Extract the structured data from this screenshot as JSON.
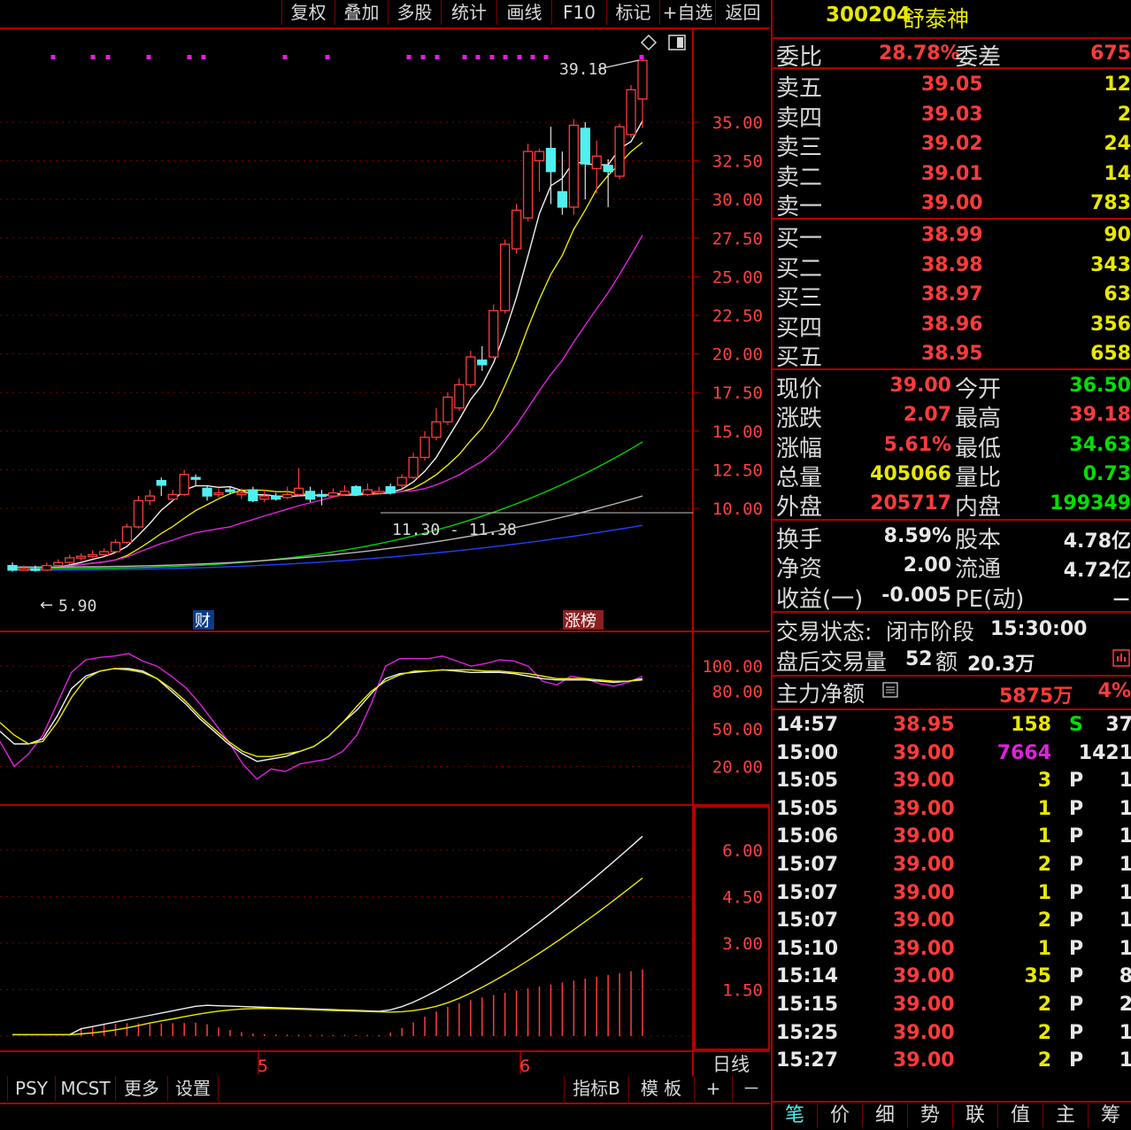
{
  "toolbar": {
    "items": [
      "复权",
      "叠加",
      "多股",
      "统计",
      "画线",
      "F10",
      "标记",
      "+自选",
      "返回"
    ]
  },
  "stock": {
    "code": "300204",
    "name": "舒泰神"
  },
  "order_ratio": {
    "label1": "委比",
    "value1": "28.78%",
    "label2": "委差",
    "value2": "675"
  },
  "sell_orders": [
    {
      "label": "卖五",
      "price": "39.05",
      "volume": "12"
    },
    {
      "label": "卖四",
      "price": "39.03",
      "volume": "2"
    },
    {
      "label": "卖三",
      "price": "39.02",
      "volume": "24"
    },
    {
      "label": "卖二",
      "price": "39.01",
      "volume": "14"
    },
    {
      "label": "卖一",
      "price": "39.00",
      "volume": "783"
    }
  ],
  "buy_orders": [
    {
      "label": "买一",
      "price": "38.99",
      "volume": "90"
    },
    {
      "label": "买二",
      "price": "38.98",
      "volume": "343"
    },
    {
      "label": "买三",
      "price": "38.97",
      "volume": "63"
    },
    {
      "label": "买四",
      "price": "38.96",
      "volume": "356"
    },
    {
      "label": "买五",
      "price": "38.95",
      "volume": "658"
    }
  ],
  "quote": [
    {
      "l1": "现价",
      "v1": "39.00",
      "l2": "今开",
      "v2": "36.50"
    },
    {
      "l1": "涨跌",
      "v1": "2.07",
      "l2": "最高",
      "v2": "39.18"
    },
    {
      "l1": "涨幅",
      "v1": "5.61%",
      "l2": "最低",
      "v2": "34.63"
    },
    {
      "l1": "总量",
      "v1": "405066",
      "l2": "量比",
      "v2": "0.73"
    },
    {
      "l1": "外盘",
      "v1": "205717",
      "l2": "内盘",
      "v2": "199349"
    }
  ],
  "fundamentals": [
    {
      "l1": "换手",
      "v1": "8.59%",
      "l2": "股本",
      "v2": "4.78亿"
    },
    {
      "l1": "净资",
      "v1": "2.00",
      "l2": "流通",
      "v2": "4.72亿"
    },
    {
      "l1": "收益(一)",
      "v1": "-0.005",
      "l2": "PE(动)",
      "v2": "－"
    }
  ],
  "trade_status": {
    "label": "交易状态:",
    "value": "闭市阶段",
    "time": "15:30:00"
  },
  "after_hours": {
    "label": "盘后交易量",
    "vol": "52",
    "amt_label": "额",
    "amt": "20.3万"
  },
  "main_force": {
    "label": "主力净额",
    "value": "5875万",
    "pct": "4%"
  },
  "ticks": [
    {
      "time": "14:57",
      "price": "38.95",
      "vol": "158",
      "flag": "S",
      "num": "37"
    },
    {
      "time": "15:00",
      "price": "39.00",
      "vol": "7664",
      "flag": "",
      "num": "1421"
    },
    {
      "time": "15:05",
      "price": "39.00",
      "vol": "3",
      "flag": "P",
      "num": "1"
    },
    {
      "time": "15:05",
      "price": "39.00",
      "vol": "1",
      "flag": "P",
      "num": "1"
    },
    {
      "time": "15:06",
      "price": "39.00",
      "vol": "1",
      "flag": "P",
      "num": "1"
    },
    {
      "time": "15:07",
      "price": "39.00",
      "vol": "2",
      "flag": "P",
      "num": "1"
    },
    {
      "time": "15:07",
      "price": "39.00",
      "vol": "1",
      "flag": "P",
      "num": "1"
    },
    {
      "time": "15:07",
      "price": "39.00",
      "vol": "2",
      "flag": "P",
      "num": "1"
    },
    {
      "time": "15:10",
      "price": "39.00",
      "vol": "1",
      "flag": "P",
      "num": "1"
    },
    {
      "time": "15:14",
      "price": "39.00",
      "vol": "35",
      "flag": "P",
      "num": "8"
    },
    {
      "time": "15:15",
      "price": "39.00",
      "vol": "2",
      "flag": "P",
      "num": "2"
    },
    {
      "time": "15:25",
      "price": "39.00",
      "vol": "2",
      "flag": "P",
      "num": "1"
    },
    {
      "time": "15:27",
      "price": "39.00",
      "vol": "2",
      "flag": "P",
      "num": "1"
    }
  ],
  "bottom_tabs_right": [
    "笔",
    "价",
    "细",
    "势",
    "联",
    "值",
    "主",
    "筹"
  ],
  "bottom_tabs_left": [
    "PSY",
    "MCST",
    "更多",
    "设置"
  ],
  "bottom_right_btns": [
    "指标B",
    "模 板",
    "+",
    "－"
  ],
  "period": "日线",
  "chart_labels": {
    "high_mark": "39.18",
    "low_mark": "5.90",
    "range_mark": "11.30 - 11.38",
    "tag1": "财",
    "tag2": "涨榜",
    "month5": "5",
    "month6": "6"
  },
  "chart_data": {
    "type": "candlestick",
    "price_axis": {
      "ticks": [
        "35.00",
        "32.50",
        "30.00",
        "27.50",
        "25.00",
        "22.50",
        "20.00",
        "17.50",
        "15.00",
        "12.50",
        "10.00"
      ],
      "range": [
        4.5,
        40.5
      ]
    },
    "kdj_axis": {
      "ticks": [
        "100.00",
        "80.00",
        "50.00",
        "20.00"
      ]
    },
    "macd_axis": {
      "ticks": [
        "6.00",
        "4.50",
        "3.00",
        "1.50"
      ]
    },
    "candles": [
      [
        6.3,
        6.0,
        6.5,
        5.9
      ],
      [
        6.0,
        6.1,
        6.3,
        5.95
      ],
      [
        6.1,
        6.0,
        6.3,
        5.9
      ],
      [
        6.0,
        6.3,
        6.5,
        5.95
      ],
      [
        6.3,
        6.5,
        6.7,
        6.2
      ],
      [
        6.5,
        6.8,
        7.0,
        6.4
      ],
      [
        6.8,
        6.9,
        7.1,
        6.6
      ],
      [
        6.9,
        7.0,
        7.3,
        6.8
      ],
      [
        7.0,
        7.2,
        7.4,
        6.9
      ],
      [
        7.2,
        7.8,
        8.0,
        7.1
      ],
      [
        7.8,
        8.8,
        9.0,
        7.7
      ],
      [
        8.8,
        10.5,
        10.8,
        8.7
      ],
      [
        10.5,
        10.8,
        11.2,
        10.2
      ],
      [
        11.8,
        11.5,
        12.0,
        10.8
      ],
      [
        10.6,
        10.9,
        11.2,
        10.5
      ],
      [
        10.9,
        12.2,
        12.5,
        10.8
      ],
      [
        12.0,
        11.9,
        12.2,
        11.5
      ],
      [
        11.3,
        10.8,
        11.5,
        10.5
      ],
      [
        10.9,
        11.0,
        11.3,
        10.7
      ],
      [
        11.2,
        11.1,
        11.4,
        10.9
      ],
      [
        11.0,
        11.0,
        11.3,
        10.6
      ],
      [
        11.2,
        10.5,
        11.4,
        10.4
      ],
      [
        10.6,
        10.8,
        11.2,
        10.4
      ],
      [
        10.8,
        10.6,
        11.0,
        10.5
      ],
      [
        10.7,
        10.9,
        11.4,
        10.6
      ],
      [
        10.9,
        11.3,
        12.6,
        10.8
      ],
      [
        11.1,
        10.6,
        11.4,
        10.4
      ],
      [
        10.9,
        10.8,
        11.2,
        10.2
      ],
      [
        10.8,
        11.0,
        11.3,
        10.7
      ],
      [
        10.9,
        11.1,
        11.5,
        10.8
      ],
      [
        11.4,
        10.9,
        11.5,
        10.8
      ],
      [
        10.9,
        11.2,
        11.6,
        10.8
      ],
      [
        11.0,
        11.1,
        11.4,
        10.9
      ],
      [
        11.4,
        11.0,
        11.6,
        10.9
      ],
      [
        11.5,
        12.0,
        12.2,
        11.3
      ],
      [
        12.0,
        13.3,
        13.6,
        11.9
      ],
      [
        13.3,
        14.6,
        15.0,
        13.1
      ],
      [
        14.6,
        15.6,
        16.5,
        14.4
      ],
      [
        15.6,
        17.2,
        17.5,
        15.4
      ],
      [
        16.5,
        18.0,
        18.4,
        16.3
      ],
      [
        18.0,
        19.8,
        20.2,
        17.8
      ],
      [
        19.6,
        19.3,
        20.5,
        18.9
      ],
      [
        19.8,
        22.8,
        23.2,
        19.7
      ],
      [
        22.8,
        27.1,
        27.4,
        22.6
      ],
      [
        26.8,
        29.3,
        29.7,
        26.5
      ],
      [
        28.8,
        33.1,
        33.6,
        28.6
      ],
      [
        32.5,
        33.1,
        33.3,
        30.5
      ],
      [
        33.3,
        31.8,
        34.7,
        29.7
      ],
      [
        30.5,
        29.5,
        33.1,
        29.0
      ],
      [
        29.5,
        34.8,
        35.2,
        29.0
      ],
      [
        34.6,
        32.3,
        35.0,
        30.0
      ],
      [
        32.0,
        32.8,
        33.8,
        30.4
      ],
      [
        32.2,
        31.8,
        32.6,
        29.5
      ],
      [
        31.5,
        34.7,
        34.9,
        31.3
      ],
      [
        34.2,
        37.1,
        37.4,
        34.0
      ],
      [
        36.5,
        39.0,
        39.18,
        34.63
      ]
    ]
  }
}
